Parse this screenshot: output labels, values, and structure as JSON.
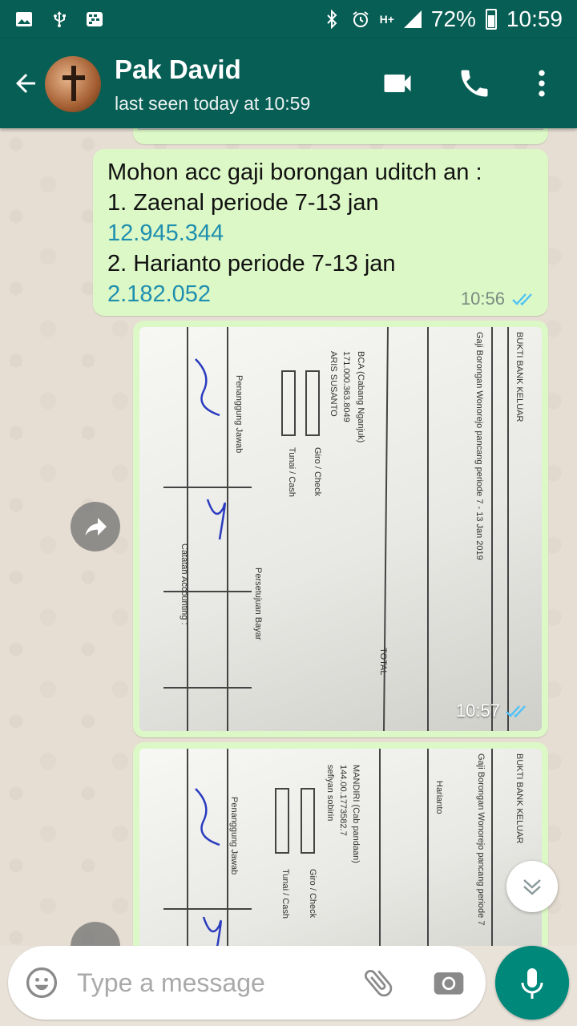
{
  "status_bar": {
    "battery": "72%",
    "time": "10:59",
    "network": "H+"
  },
  "header": {
    "contact_name": "Pak David",
    "last_seen": "last seen today at 10:59"
  },
  "messages": [
    {
      "type": "text",
      "lines": [
        {
          "text": "Mohon acc gaji borongan uditch an :",
          "link": false
        },
        {
          "text": "1. Zaenal periode 7-13 jan",
          "link": false
        },
        {
          "text": "12.945.344",
          "link": true
        },
        {
          "text": "2. Harianto periode 7-13 jan",
          "link": false
        },
        {
          "text": "2.182.052",
          "link": true
        }
      ],
      "time": "10:56",
      "status": "read"
    },
    {
      "type": "image",
      "caption_texts": [
        "BUKTI BANK KELUAR",
        "Gaji Borongan Wonorejo pancang periode 7 - 13 Jan 2019",
        "BCA (Cabang Nganjuk)",
        "171.000.363.8049",
        "ARIS SUSANTO",
        "Giro / Check",
        "Tunai / Cash",
        "Penanggung Jawab",
        "Catatan Accounting :",
        "Persetujuan Bayar",
        "TOTAL"
      ],
      "time": "10:57",
      "status": "read"
    },
    {
      "type": "image",
      "caption_texts": [
        "BUKTI BANK KELUAR",
        "Gaji Borongan Wonorejo pancang periode 7",
        "MANDIRI (Cab pandaan)",
        "144.00.1773582.7",
        "sefiyan sobirin",
        "Harianto",
        "Giro / Check",
        "Tunai / Cash",
        "Penanggung Jawab"
      ],
      "time": "",
      "status": ""
    }
  ],
  "composer": {
    "placeholder": "Type a message"
  },
  "colors": {
    "header": "#075e54",
    "bubble_out": "#dcf8c6",
    "read_ticks": "#4fc3f7",
    "link": "#1f8fb0",
    "mic_button": "#00897b"
  },
  "icons": [
    "back-arrow-icon",
    "video-call-icon",
    "phone-icon",
    "more-vert-icon",
    "share-icon",
    "chevron-down-icon",
    "emoji-icon",
    "attach-icon",
    "camera-icon",
    "mic-icon"
  ]
}
